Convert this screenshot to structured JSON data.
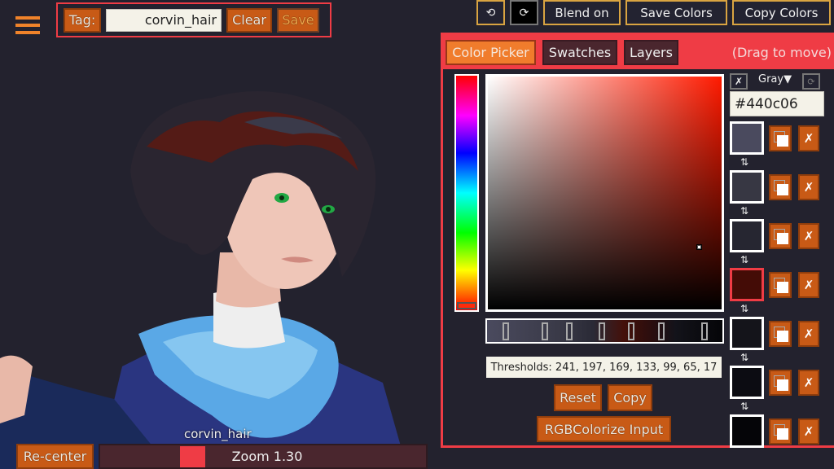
{
  "menu": {
    "icon": "hamburger-icon"
  },
  "tagbar": {
    "label": "Tag:",
    "input_value": "corvin_hair",
    "clear_label": "Clear",
    "save_label": "Save"
  },
  "toolbar": {
    "undo_icon": "⟲",
    "redo_icon": "⟳",
    "blend_label": "Blend on",
    "save_colors_label": "Save Colors",
    "copy_colors_label": "Copy Colors"
  },
  "panel": {
    "tabs": [
      {
        "label": "Color Picker",
        "active": true
      },
      {
        "label": "Swatches",
        "active": false
      },
      {
        "label": "Layers",
        "active": false
      }
    ],
    "drag_hint": "(Drag to move)",
    "hue_selected": "#ff2a0a",
    "thresholds_text": "Thresholds: 241, 197, 169, 133, 99, 65, 17",
    "reset_label": "Reset",
    "copy_label": "Copy",
    "rgbcolorize_label": "RGBColorize Input",
    "gradient_handles": [
      241,
      197,
      169,
      133,
      99,
      65,
      17
    ]
  },
  "swatches": {
    "clear_icon": "✗",
    "mode_label": "Gray▼",
    "refresh_icon": "⟳",
    "hex_value": "#440c06",
    "swap_icon": "⇅",
    "delete_icon": "✗",
    "items": [
      {
        "color": "#4a4a5e",
        "selected": false
      },
      {
        "color": "#373743",
        "selected": false
      },
      {
        "color": "#262631",
        "selected": false
      },
      {
        "color": "#440c06",
        "selected": true
      },
      {
        "color": "#14141a",
        "selected": false
      },
      {
        "color": "#0c0c12",
        "selected": false
      },
      {
        "color": "#050508",
        "selected": false
      }
    ]
  },
  "canvas": {
    "layer_name": "corvin_hair"
  },
  "bottom": {
    "recenter_label": "Re-center",
    "zoom_label": "Zoom 1.30",
    "zoom_value": 1.3
  },
  "colors": {
    "accent_red": "#ef3c45",
    "button_orange": "#c85a16",
    "active_tab_orange": "#f07c2c",
    "background": "#23222e",
    "toolbar_border_gold": "#d9a441"
  }
}
